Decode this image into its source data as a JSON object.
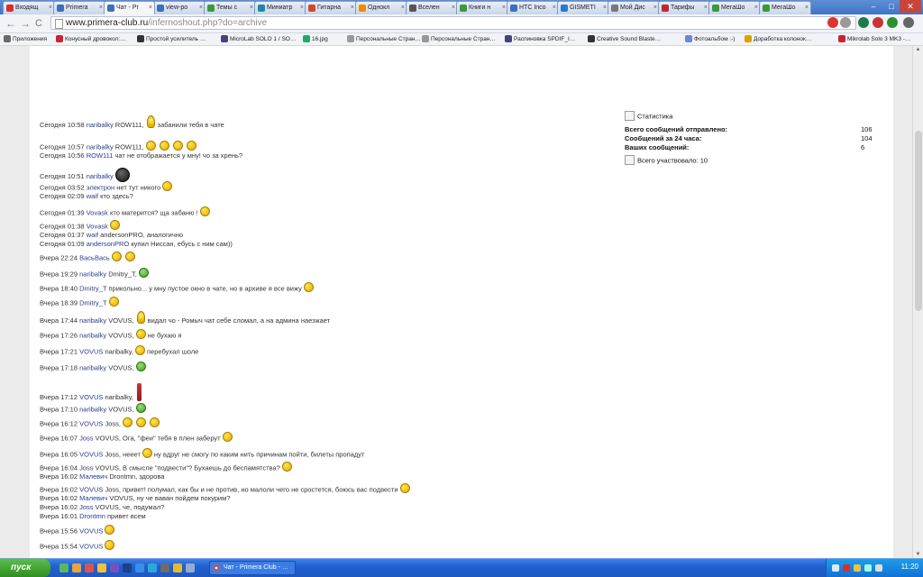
{
  "tabs": [
    {
      "label": "Входящ",
      "color": "#d93025"
    },
    {
      "label": "Primera",
      "color": "#3c6fb6"
    },
    {
      "label": "Чат - Pr",
      "color": "#3c6fb6",
      "active": true
    },
    {
      "label": "view-po",
      "color": "#3c6fb6"
    },
    {
      "label": "Темы с",
      "color": "#3a9a3a"
    },
    {
      "label": "Миниатр",
      "color": "#1a8aa8"
    },
    {
      "label": "Гитарна",
      "color": "#ce4a2b"
    },
    {
      "label": "Однокл",
      "color": "#f08a00"
    },
    {
      "label": "Вселен",
      "color": "#555555"
    },
    {
      "label": "Книги н",
      "color": "#3a9a3a"
    },
    {
      "label": "HTC Inco",
      "color": "#3a6fc0"
    },
    {
      "label": "GISMETI",
      "color": "#2a7ac8"
    },
    {
      "label": "Мой Дис",
      "color": "#777777"
    },
    {
      "label": "Тарифы",
      "color": "#c0282d"
    },
    {
      "label": "МегаШо",
      "color": "#3a9a3a"
    },
    {
      "label": "МегаШо",
      "color": "#3a9a3a"
    }
  ],
  "url": {
    "host": "www.primera-club.ru",
    "path": "/infernoshout.php?do=archive"
  },
  "bookmarks": [
    {
      "label": "Приложения",
      "color": "#6a6a6a"
    },
    {
      "label": "Конусный дровокол:…",
      "color": "#c23"
    },
    {
      "label": "Простой усилитель …",
      "color": "#333"
    },
    {
      "label": "MicroLab SOLO 1 / SO…",
      "color": "#447"
    },
    {
      "label": "16.jpg",
      "color": "#2a6"
    },
    {
      "label": "Персональные Стран…",
      "color": "#999"
    },
    {
      "label": "Персональные Стран…",
      "color": "#999"
    },
    {
      "label": "Распиновка SPDIF_I…",
      "color": "#447"
    },
    {
      "label": "Creative Sound Blaste…",
      "color": "#333"
    },
    {
      "label": "Фотоальбом :-)",
      "color": "#6a8ad0"
    },
    {
      "label": "Доработка колонок…",
      "color": "#d8a200"
    },
    {
      "label": "Mikrolab Solo 3 MK3 -…",
      "color": "#c23"
    }
  ],
  "messages": [
    {
      "time": "Сегодня 10:58",
      "nick": "naribalky",
      "text": " ROW111,",
      "icons": [
        "bulb"
      ],
      "tail": "забанили тебя в чате"
    },
    {
      "time": "Сегодня 10:57",
      "nick": "naribalky",
      "text": " ROW111,",
      "icons": [
        "sm",
        "sm",
        "sm",
        "sm"
      ],
      "tail": ""
    },
    {
      "time": "Сегодня 10:56",
      "nick": "ROW111",
      "text": " чат не отображается у мну! чо за хрень?",
      "icons": [],
      "tail": ""
    },
    {
      "time": "Сегодня 10:51",
      "nick": "naribalky",
      "text": "",
      "icons": [
        "dark big"
      ],
      "tail": ""
    },
    {
      "time": "Сегодня 03:52",
      "nick": "электрон",
      "text": " нет тут никого",
      "icons": [
        "sm"
      ],
      "tail": ""
    },
    {
      "time": "Сегодня 02:09",
      "nick": "waif",
      "text": " кто здесь?",
      "icons": [],
      "tail": ""
    },
    {
      "time": "Сегодня 01:39",
      "nick": "Vovask",
      "text": " кто матерится? ща забаню !",
      "icons": [
        "sm"
      ],
      "tail": ""
    },
    {
      "time": "Сегодня 01:38",
      "nick": "Vovask",
      "text": "",
      "icons": [
        "sm"
      ],
      "tail": ""
    },
    {
      "time": "Сегодня 01:37",
      "nick": "waif",
      "text": " andersonPRO, аналогично",
      "icons": [],
      "tail": ""
    },
    {
      "time": "Сегодня 01:09",
      "nick": "andersonPRO",
      "text": " купил Ниссан, ебусь с ним сам))",
      "icons": [],
      "tail": ""
    },
    {
      "time": "Вчера 22:24",
      "nick": "ВасьВась",
      "text": "",
      "icons": [
        "sm",
        "sm"
      ],
      "tail": ""
    },
    {
      "time": "Вчера 19:29",
      "nick": "naribalky",
      "text": " Dmitry_T,",
      "icons": [
        "green"
      ],
      "tail": ""
    },
    {
      "time": "Вчера 18:40",
      "nick": "Dmitry_T",
      "text": " прикольно... у мну пустое окно в чате, но в архиве я все вижу",
      "icons": [
        "sm"
      ],
      "tail": ""
    },
    {
      "time": "Вчера 18:39",
      "nick": "Dmitry_T",
      "text": "",
      "icons": [
        "sm"
      ],
      "tail": ""
    },
    {
      "time": "Вчера 17:44",
      "nick": "naribalky",
      "text": " VOVUS,",
      "icons": [
        "bulb"
      ],
      "tail": "видал чо - Ромыч чат себе сломал, а на админа наезжает"
    },
    {
      "time": "Вчера 17:26",
      "nick": "naribalky",
      "text": " VOVUS,",
      "icons": [
        "sm"
      ],
      "tail": "не бухаю я"
    },
    {
      "time": "Вчера 17:21",
      "nick": "VOVUS",
      "text": " naribalky,",
      "icons": [
        "sm"
      ],
      "tail": "перебухал шоле"
    },
    {
      "time": "Вчера 17:18",
      "nick": "naribalky",
      "text": " VOVUS,",
      "icons": [
        "green"
      ],
      "tail": ""
    },
    {
      "time": "Вчера 17:12",
      "nick": "VOVUS",
      "text": " naribalky,",
      "icons": [
        "bottle"
      ],
      "tail": ""
    },
    {
      "time": "Вчера 17:10",
      "nick": "naribalky",
      "text": " VOVUS,",
      "icons": [
        "green"
      ],
      "tail": ""
    },
    {
      "time": "Вчера 16:12",
      "nick": "VOVUS",
      "text": " Joss,",
      "icons": [
        "sm",
        "sm",
        "sm"
      ],
      "tail": ""
    },
    {
      "time": "Вчера 16:07",
      "nick": "Joss",
      "text": " VOVUS, Ога, \"феи\" тебя в плен заберут",
      "icons": [
        "sm"
      ],
      "tail": ""
    },
    {
      "time": "Вчера 16:05",
      "nick": "VOVUS",
      "text": " Joss, нееет",
      "icons": [
        "sm"
      ],
      "tail": "ну вдруг не смогу по каким нить причинам пойти, билеты пропадут"
    },
    {
      "time": "Вчера 16:04",
      "nick": "Joss",
      "text": " VOVUS, В смысле \"подвести\"? Бухаешь до беспамятства?",
      "icons": [
        "sm"
      ],
      "tail": ""
    },
    {
      "time": "Вчера 16:02",
      "nick": "Малевич",
      "text": " Drontmn, здорова",
      "icons": [],
      "tail": ""
    },
    {
      "time": "Вчера 16:02",
      "nick": "VOVUS",
      "text": " Joss, привет! полумал, как бы и не против, но малоли чего не сростется, боюсь вас подвести",
      "icons": [
        "sm"
      ],
      "tail": ""
    },
    {
      "time": "Вчера 16:02",
      "nick": "Малевич",
      "text": " VOVUS, ну че ваван пойдем покурим?",
      "icons": [],
      "tail": ""
    },
    {
      "time": "Вчера 16:02",
      "nick": "Joss",
      "text": " VOVUS, че, подумал?",
      "icons": [],
      "tail": ""
    },
    {
      "time": "Вчера 16:01",
      "nick": "Drontmn",
      "text": " привет всем",
      "icons": [],
      "tail": ""
    },
    {
      "time": "Вчера 15:56",
      "nick": "VOVUS",
      "text": "",
      "icons": [
        "sm"
      ],
      "tail": ""
    },
    {
      "time": "Вчера 15:54",
      "nick": "VOVUS",
      "text": "",
      "icons": [
        "sm"
      ],
      "tail": ""
    }
  ],
  "stats": {
    "title": "Статистика",
    "total_label": "Всего сообщений отправлено:",
    "total_value": "106",
    "day_label": "Сообщений за 24 часа:",
    "day_value": "104",
    "yours_label": "Ваших сообщений:",
    "yours_value": "6",
    "participants": "Всего участвовало: 10"
  },
  "taskbar": {
    "start": "пуск",
    "task": "Чат - Primera Club - …",
    "clock": "11:20"
  }
}
